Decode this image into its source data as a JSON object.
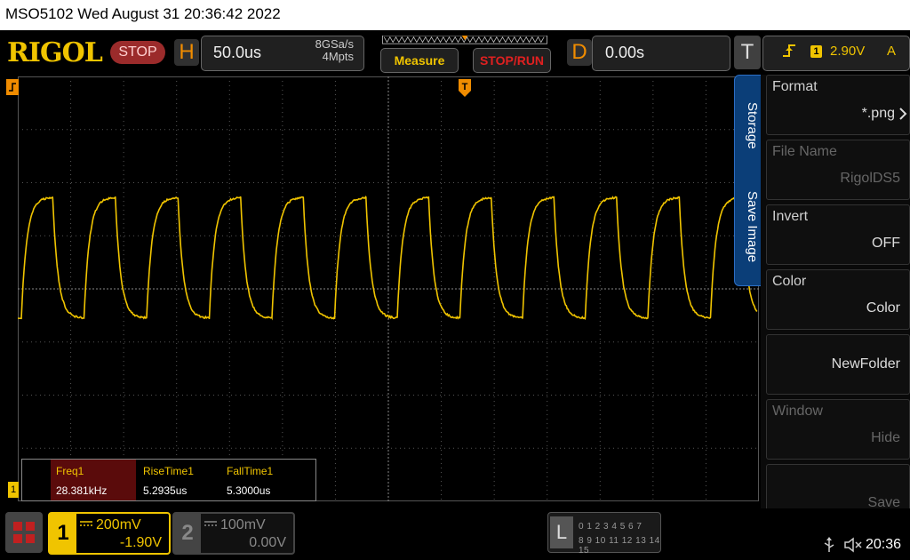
{
  "title_bar": {
    "text": "MSO5102  Wed August 31 20:36:42 2022"
  },
  "toolbar": {
    "logo": "RIGOL",
    "run_state": "STOP",
    "horizontal_letter": "H",
    "timebase": "50.0us",
    "sample_rate": "8GSa/s",
    "memory_depth": "4Mpts",
    "measure_label": "Measure",
    "stop_run_label": "STOP/RUN",
    "delay_letter": "D",
    "delay": "0.00s",
    "trigger_letter": "T",
    "trigger_source": "1",
    "trigger_level": "2.90V",
    "trigger_mode": "A"
  },
  "waveform": {
    "channel": "1",
    "color": "#f0c400",
    "cycles_shown": 12
  },
  "measurements": [
    {
      "name": "Freq1",
      "value": "28.381kHz"
    },
    {
      "name": "RiseTime1",
      "value": "5.2935us"
    },
    {
      "name": "FallTime1",
      "value": "5.3000us"
    }
  ],
  "side_tab": {
    "storage": "Storage",
    "save_image": "Save Image"
  },
  "menu": [
    {
      "title": "Format",
      "value": "*.png",
      "dim": false
    },
    {
      "title": "File Name",
      "value": "RigolDS5",
      "dim": true
    },
    {
      "title": "Invert",
      "value": "OFF",
      "dim": false
    },
    {
      "title": "Color",
      "value": "Color",
      "dim": false
    },
    {
      "title": "",
      "value": "NewFolder",
      "dim": false
    },
    {
      "title": "Window",
      "value": "Hide",
      "dim": true
    },
    {
      "title": "",
      "value": "Save",
      "dim": true
    }
  ],
  "bottom": {
    "ch1": {
      "num": "1",
      "scale": "200mV",
      "offset": "-1.90V"
    },
    "ch2": {
      "num": "2",
      "scale": "100mV",
      "offset": "0.00V"
    },
    "logic": {
      "letter": "L",
      "row1": "0 1 2 3   4 5 6 7",
      "row2": "8 9 10 11 12 13 14 15"
    },
    "time": "20:36"
  },
  "colors": {
    "accent": "#f0c400",
    "orange": "#f08c00",
    "stop_red": "#e02020",
    "menu_blue": "#0b3e78"
  },
  "icons": [
    "grid-menu-icon",
    "usb-icon",
    "speaker-mute-icon",
    "trigger-rising-edge-icon",
    "menu-arrow-right-icon"
  ]
}
